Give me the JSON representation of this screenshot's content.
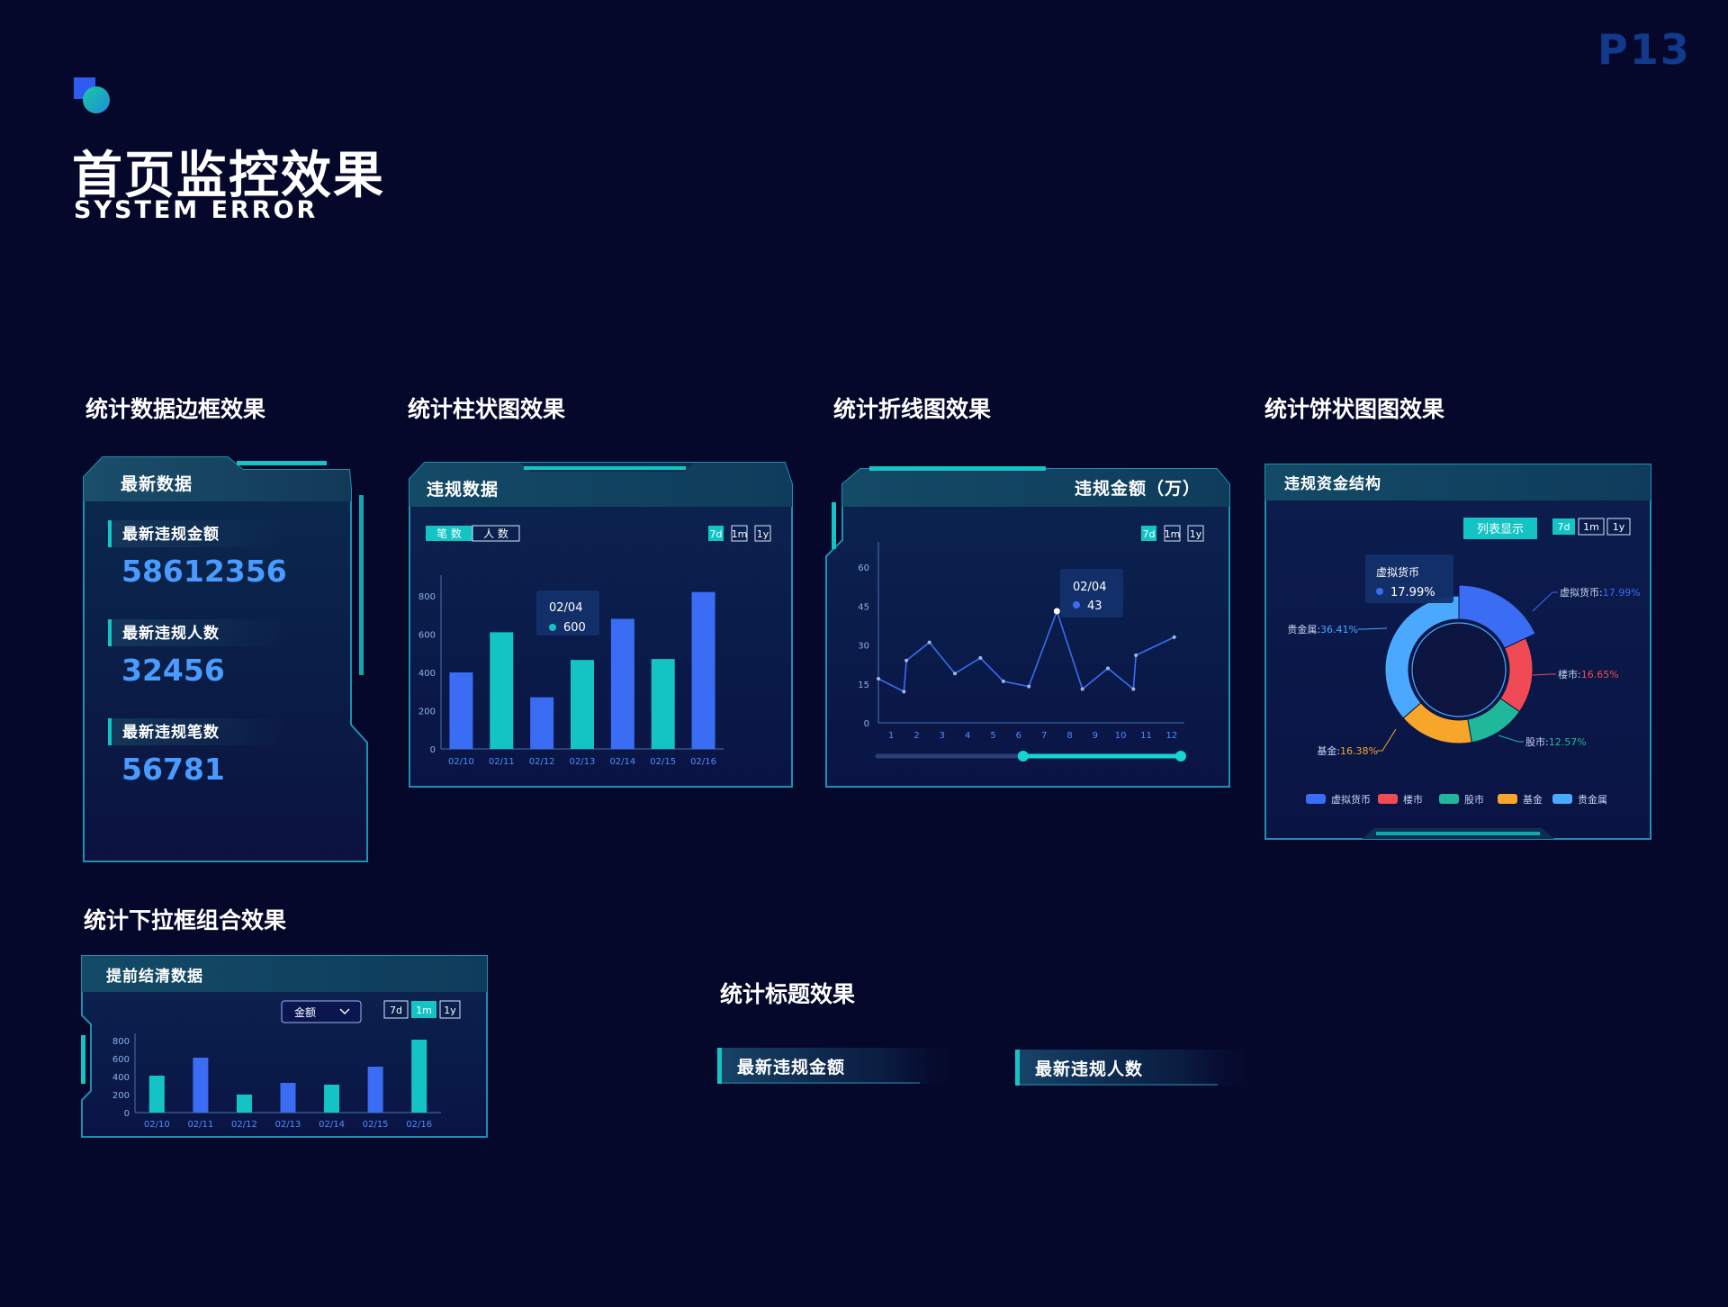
{
  "page_number": "P13",
  "header": {
    "title": "首页监控效果",
    "subtitle": "SYSTEM ERROR"
  },
  "sections": {
    "border": "统计数据边框效果",
    "bar": "统计柱状图效果",
    "line": "统计折线图效果",
    "pie": "统计饼状图图效果",
    "dropdown": "统计下拉框组合效果",
    "title": "统计标题效果"
  },
  "colors": {
    "background": "#05082a",
    "cyan": "#14c4c4",
    "blue": "#3a6cf4",
    "number_blue": "#4a9bff",
    "frame": "#1f8fb0"
  },
  "stats_panel": {
    "title": "最新数据",
    "items": [
      {
        "label": "最新违规金额",
        "value": "58612356"
      },
      {
        "label": "最新违规人数",
        "value": "32456"
      },
      {
        "label": "最新违规笔数",
        "value": "56781"
      }
    ]
  },
  "bar_panel": {
    "title": "违规数据",
    "toggle": [
      "笔 数",
      "人 数"
    ],
    "ranges": [
      "7d",
      "1m",
      "1y"
    ],
    "tooltip": {
      "date": "02/04",
      "value": "600"
    }
  },
  "line_panel": {
    "title": "违规金额（万）",
    "ranges": [
      "7d",
      "1m",
      "1y"
    ],
    "tooltip": {
      "date": "02/04",
      "value": "43"
    }
  },
  "pie_panel": {
    "title": "违规资金结构",
    "list_button": "列表显示",
    "ranges": [
      "7d",
      "1m",
      "1y"
    ],
    "tooltip": {
      "name": "虚拟货币",
      "value": "17.99%"
    },
    "slice_labels": [
      {
        "name": "虚拟货币",
        "text": "虚拟货币:",
        "pct": "17.99%",
        "color": "#3a6cf4"
      },
      {
        "name": "楼市",
        "text": "楼市:",
        "pct": "16.65%",
        "color": "#f04b55"
      },
      {
        "name": "股市",
        "text": "股市:",
        "pct": "12.57%",
        "color": "#1fb89a"
      },
      {
        "name": "基金",
        "text": "基金:",
        "pct": "16.38%",
        "color": "#f7a62a"
      },
      {
        "name": "贵金属",
        "text": "贵金属:",
        "pct": "36.41%",
        "color": "#4aa8ff"
      }
    ],
    "legend": [
      "虚拟货币",
      "楼市",
      "股市",
      "基金",
      "贵金属"
    ]
  },
  "dropdown_panel": {
    "title": "提前结清数据",
    "select_value": "金额",
    "ranges": [
      "7d",
      "1m",
      "1y"
    ]
  },
  "title_effects": [
    "最新违规金额",
    "最新违规人数"
  ],
  "chart_data": [
    {
      "type": "bar",
      "title": "违规数据",
      "categories": [
        "02/10",
        "02/11",
        "02/12",
        "02/13",
        "02/14",
        "02/15",
        "02/16"
      ],
      "values": [
        400,
        610,
        270,
        465,
        680,
        470,
        820
      ],
      "colors": [
        "#3a6cf4",
        "#14c4c4",
        "#3a6cf4",
        "#14c4c4",
        "#3a6cf4",
        "#14c4c4",
        "#3a6cf4"
      ],
      "yticks": [
        0,
        200,
        400,
        600,
        800
      ],
      "ylim": [
        0,
        880
      ]
    },
    {
      "type": "line",
      "title": "违规金额（万）",
      "x": [
        1,
        2,
        3,
        4,
        5,
        6,
        7,
        8,
        9,
        10,
        11,
        12
      ],
      "points": [
        [
          0,
          17
        ],
        [
          1,
          12
        ],
        [
          1.1,
          24
        ],
        [
          2,
          31
        ],
        [
          3,
          19
        ],
        [
          4,
          25
        ],
        [
          4.9,
          16
        ],
        [
          5.9,
          14
        ],
        [
          7,
          43
        ],
        [
          8,
          13
        ],
        [
          9,
          21
        ],
        [
          10,
          13
        ],
        [
          10.1,
          26
        ],
        [
          11.6,
          33
        ]
      ],
      "yticks": [
        0,
        15,
        30,
        45,
        60
      ],
      "ylim": [
        0,
        60
      ],
      "range_slider": {
        "start": 0.48,
        "end": 1.0
      }
    },
    {
      "type": "pie",
      "title": "违规资金结构",
      "labels": [
        "虚拟货币",
        "楼市",
        "股市",
        "基金",
        "贵金属"
      ],
      "values": [
        17.99,
        16.65,
        12.57,
        16.38,
        36.41
      ],
      "colors": [
        "#3a6cf4",
        "#f04b55",
        "#1fb89a",
        "#f7a62a",
        "#4aa8ff"
      ]
    },
    {
      "type": "bar",
      "title": "提前结清数据",
      "categories": [
        "02/10",
        "02/11",
        "02/12",
        "02/13",
        "02/14",
        "02/15",
        "02/16"
      ],
      "values": [
        410,
        610,
        200,
        330,
        310,
        510,
        810
      ],
      "colors": [
        "#14c4c4",
        "#3a6cf4",
        "#14c4c4",
        "#3a6cf4",
        "#14c4c4",
        "#3a6cf4",
        "#14c4c4"
      ],
      "yticks": [
        0,
        200,
        400,
        600,
        800
      ],
      "ylim": [
        0,
        820
      ]
    }
  ]
}
